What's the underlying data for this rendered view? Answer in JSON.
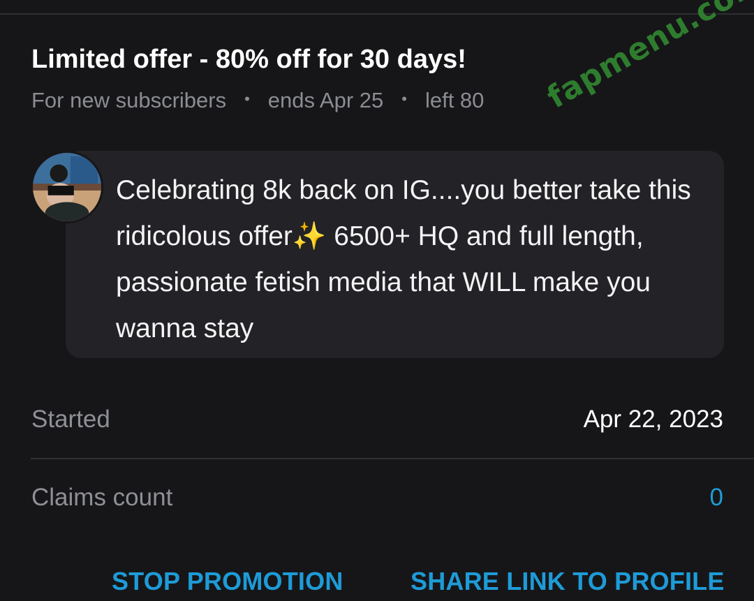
{
  "offer": {
    "title": "Limited offer - 80% off for 30 days!",
    "audience": "For new subscribers",
    "ends": "ends Apr 25",
    "left": "left 80",
    "separator": "•"
  },
  "watermark": {
    "text": "fapmenu.com",
    "color": "#2e7d2e"
  },
  "message": {
    "avatar_icon": "user-avatar",
    "text": "Celebrating 8k back on IG....you better take this ridicolous offer✨ 6500+ HQ and full length, passionate fetish media that WILL make you wanna stay"
  },
  "details": {
    "started_label": "Started",
    "started_value": "Apr 22, 2023",
    "claims_label": "Claims count",
    "claims_value": "0"
  },
  "actions": {
    "stop_label": "STOP PROMOTION",
    "share_label": "SHARE LINK TO PROFILE"
  },
  "colors": {
    "background": "#161618",
    "card": "#232327",
    "accent": "#1e9bd7",
    "muted_text": "#8b8d92"
  }
}
